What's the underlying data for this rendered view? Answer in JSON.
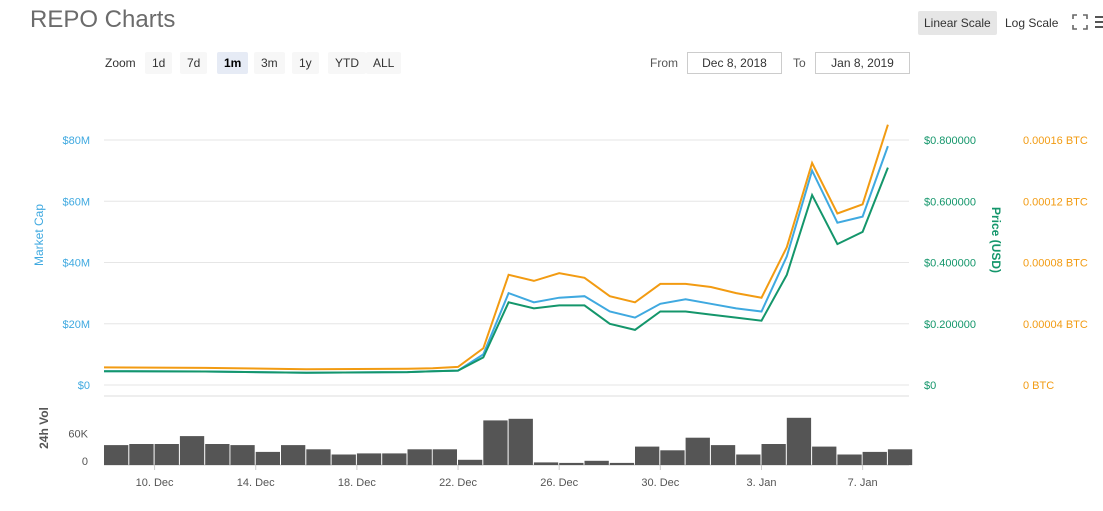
{
  "title": "REPO Charts",
  "scale_buttons": {
    "linear": "Linear Scale",
    "log": "Log Scale"
  },
  "zoom": {
    "label": "Zoom",
    "options": [
      "1d",
      "7d",
      "1m",
      "3m",
      "1y",
      "YTD",
      "ALL"
    ],
    "active": "1m"
  },
  "range": {
    "from_label": "From",
    "from": "Dec 8, 2018",
    "to_label": "To",
    "to": "Jan 8, 2019"
  },
  "icons": {
    "fullscreen": "fullscreen-icon",
    "menu": "menu-icon"
  },
  "colors": {
    "market_cap": "#3fa9e0",
    "price_usd": "#14966b",
    "price_btc": "#f29b12",
    "volume": "#555555",
    "grid": "#e6e6e6"
  },
  "chart_data": [
    {
      "type": "line",
      "x_ticks": [
        "10. Dec",
        "14. Dec",
        "18. Dec",
        "22. Dec",
        "26. Dec",
        "30. Dec",
        "3. Jan",
        "7. Jan"
      ],
      "x_range": [
        "2018-12-08",
        "2019-01-08"
      ],
      "axes": {
        "market_cap": {
          "label": "Market Cap",
          "ticks": [
            "$0",
            "$20M",
            "$40M",
            "$60M",
            "$80M"
          ],
          "range": [
            0,
            80
          ]
        },
        "price_usd": {
          "label": "Price (USD)",
          "ticks": [
            "$0",
            "$0.200000",
            "$0.400000",
            "$0.600000",
            "$0.800000"
          ],
          "range": [
            0,
            0.8
          ]
        },
        "price_btc": {
          "label": "",
          "ticks": [
            "0 BTC",
            "0.00004 BTC",
            "0.00008 BTC",
            "0.00012 BTC",
            "0.00016 BTC"
          ],
          "range": [
            0,
            0.00016
          ]
        }
      },
      "series": [
        {
          "name": "Market Cap",
          "axis": "market_cap",
          "points": [
            [
              "2018-12-08",
              4.5
            ],
            [
              "2018-12-12",
              4.4
            ],
            [
              "2018-12-16",
              4.0
            ],
            [
              "2018-12-20",
              4.2
            ],
            [
              "2018-12-21",
              4.5
            ],
            [
              "2018-12-22",
              4.7
            ],
            [
              "2018-12-23",
              10
            ],
            [
              "2018-12-24",
              30
            ],
            [
              "2018-12-25",
              27
            ],
            [
              "2018-12-26",
              28.5
            ],
            [
              "2018-12-27",
              29
            ],
            [
              "2018-12-28",
              24
            ],
            [
              "2018-12-29",
              22
            ],
            [
              "2018-12-30",
              26.5
            ],
            [
              "2018-12-31",
              28
            ],
            [
              "2019-01-01",
              26.5
            ],
            [
              "2019-01-02",
              25
            ],
            [
              "2019-01-03",
              24
            ],
            [
              "2019-01-04",
              42
            ],
            [
              "2019-01-05",
              70
            ],
            [
              "2019-01-06",
              53
            ],
            [
              "2019-01-07",
              55
            ],
            [
              "2019-01-08",
              78
            ]
          ]
        },
        {
          "name": "Price (USD)",
          "axis": "price_usd",
          "points": [
            [
              "2018-12-08",
              0.045
            ],
            [
              "2018-12-12",
              0.044
            ],
            [
              "2018-12-16",
              0.04
            ],
            [
              "2018-12-20",
              0.042
            ],
            [
              "2018-12-21",
              0.045
            ],
            [
              "2018-12-22",
              0.047
            ],
            [
              "2018-12-23",
              0.09
            ],
            [
              "2018-12-24",
              0.27
            ],
            [
              "2018-12-25",
              0.25
            ],
            [
              "2018-12-26",
              0.26
            ],
            [
              "2018-12-27",
              0.26
            ],
            [
              "2018-12-28",
              0.2
            ],
            [
              "2018-12-29",
              0.18
            ],
            [
              "2018-12-30",
              0.24
            ],
            [
              "2018-12-31",
              0.24
            ],
            [
              "2019-01-01",
              0.23
            ],
            [
              "2019-01-02",
              0.22
            ],
            [
              "2019-01-03",
              0.21
            ],
            [
              "2019-01-04",
              0.36
            ],
            [
              "2019-01-05",
              0.62
            ],
            [
              "2019-01-06",
              0.46
            ],
            [
              "2019-01-07",
              0.5
            ],
            [
              "2019-01-08",
              0.71
            ]
          ]
        },
        {
          "name": "Price (BTC)",
          "axis": "price_btc",
          "points": [
            [
              "2018-12-08",
              1.15e-05
            ],
            [
              "2018-12-12",
              1.12e-05
            ],
            [
              "2018-12-16",
              1.03e-05
            ],
            [
              "2018-12-20",
              1.06e-05
            ],
            [
              "2018-12-21",
              1.1e-05
            ],
            [
              "2018-12-22",
              1.18e-05
            ],
            [
              "2018-12-23",
              2.4e-05
            ],
            [
              "2018-12-24",
              7.2e-05
            ],
            [
              "2018-12-25",
              6.8e-05
            ],
            [
              "2018-12-26",
              7.3e-05
            ],
            [
              "2018-12-27",
              7e-05
            ],
            [
              "2018-12-28",
              5.8e-05
            ],
            [
              "2018-12-29",
              5.4e-05
            ],
            [
              "2018-12-30",
              6.6e-05
            ],
            [
              "2018-12-31",
              6.6e-05
            ],
            [
              "2019-01-01",
              6.4e-05
            ],
            [
              "2019-01-02",
              6e-05
            ],
            [
              "2019-01-03",
              5.7e-05
            ],
            [
              "2019-01-04",
              9e-05
            ],
            [
              "2019-01-05",
              0.000145
            ],
            [
              "2019-01-06",
              0.000112
            ],
            [
              "2019-01-07",
              0.000118
            ],
            [
              "2019-01-08",
              0.00017
            ]
          ]
        }
      ]
    },
    {
      "type": "bar",
      "ylabel": "24h Vol",
      "ticks": [
        "0",
        "60K"
      ],
      "ylim": [
        0,
        120
      ],
      "series": [
        {
          "name": "24h Vol",
          "points": [
            [
              "2018-12-08",
              38
            ],
            [
              "2018-12-09",
              40
            ],
            [
              "2018-12-10",
              40
            ],
            [
              "2018-12-11",
              55
            ],
            [
              "2018-12-12",
              40
            ],
            [
              "2018-12-13",
              38
            ],
            [
              "2018-12-14",
              25
            ],
            [
              "2018-12-15",
              38
            ],
            [
              "2018-12-16",
              30
            ],
            [
              "2018-12-17",
              20
            ],
            [
              "2018-12-18",
              22
            ],
            [
              "2018-12-19",
              22
            ],
            [
              "2018-12-20",
              30
            ],
            [
              "2018-12-21",
              30
            ],
            [
              "2018-12-22",
              10
            ],
            [
              "2018-12-23",
              85
            ],
            [
              "2018-12-24",
              88
            ],
            [
              "2018-12-25",
              5
            ],
            [
              "2018-12-26",
              4
            ],
            [
              "2018-12-27",
              8
            ],
            [
              "2018-12-28",
              4
            ],
            [
              "2018-12-29",
              35
            ],
            [
              "2018-12-30",
              28
            ],
            [
              "2018-12-31",
              52
            ],
            [
              "2019-01-01",
              38
            ],
            [
              "2019-01-02",
              20
            ],
            [
              "2019-01-03",
              40
            ],
            [
              "2019-01-04",
              90
            ],
            [
              "2019-01-05",
              35
            ],
            [
              "2019-01-06",
              20
            ],
            [
              "2019-01-07",
              25
            ],
            [
              "2019-01-08",
              30
            ]
          ]
        }
      ]
    }
  ]
}
